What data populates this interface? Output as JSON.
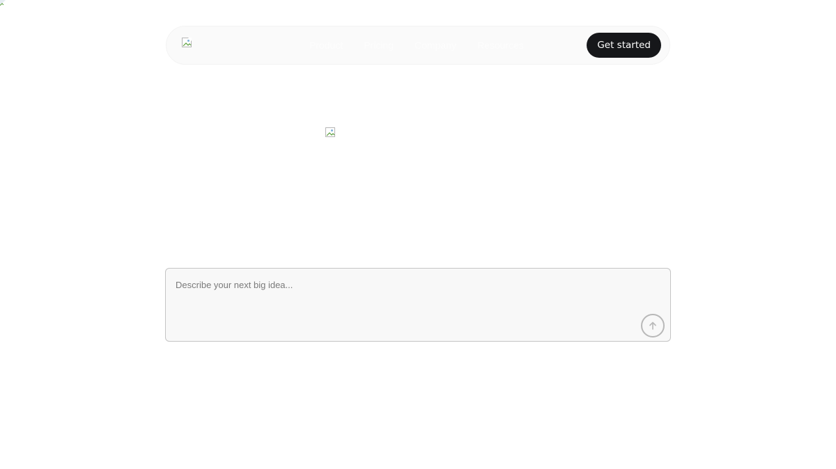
{
  "navbar": {
    "links": [
      "Product",
      "Pricing",
      "Company",
      "Resources"
    ],
    "cta_label": "Get started"
  },
  "prompt": {
    "placeholder": "Describe your next big idea...",
    "value": ""
  },
  "icons": {
    "corner": "broken-image-icon",
    "logo": "broken-image-icon",
    "hero": "broken-image-icon",
    "submit": "arrow-up-icon"
  },
  "colors": {
    "cta_background": "#16171a",
    "cta_text": "#ffffff",
    "navbar_background": "#fafafa",
    "prompt_background": "#f8f8f8",
    "prompt_border": "#c4c4c4"
  }
}
